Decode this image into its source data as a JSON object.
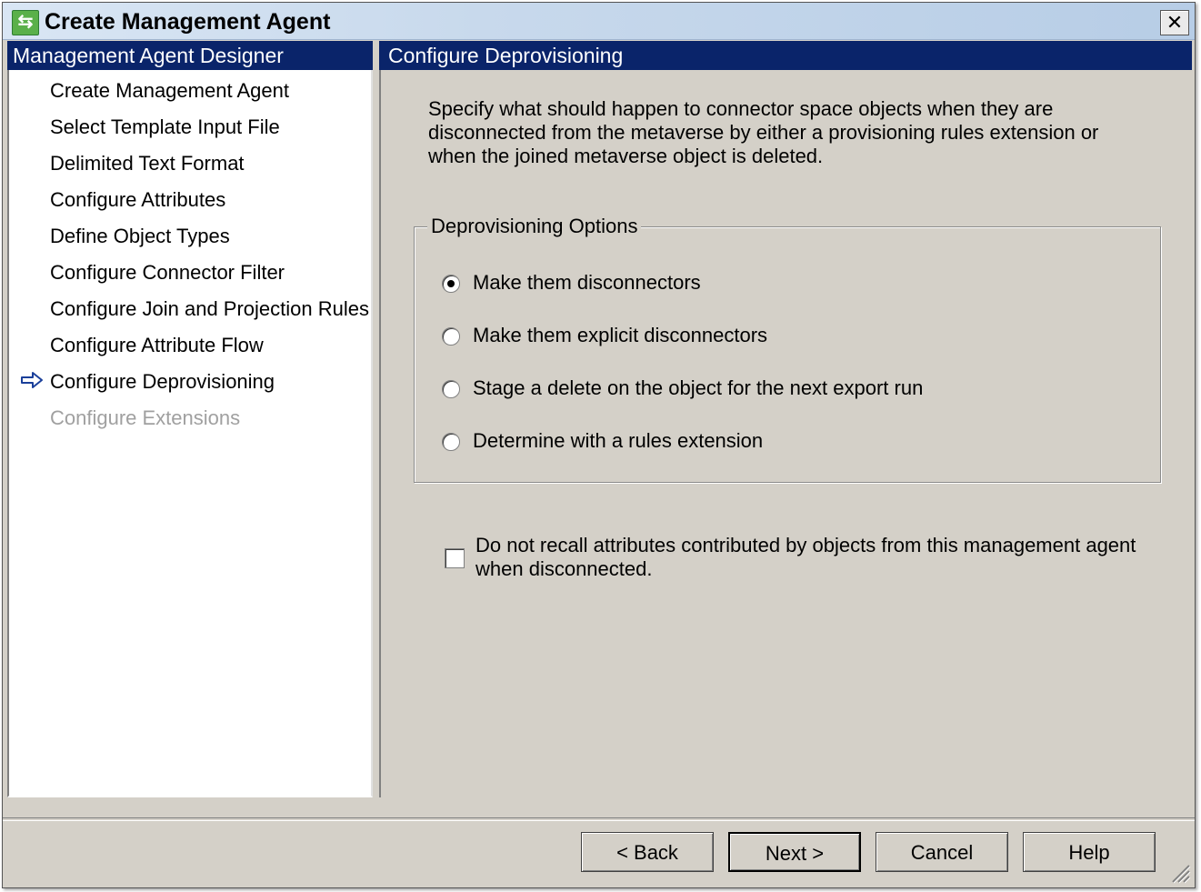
{
  "window": {
    "title": "Create Management Agent",
    "close_label": "✕"
  },
  "left_panel": {
    "header": "Management Agent Designer",
    "items": [
      {
        "label": "Create Management Agent",
        "state": "normal"
      },
      {
        "label": "Select Template Input File",
        "state": "normal"
      },
      {
        "label": "Delimited Text Format",
        "state": "normal"
      },
      {
        "label": "Configure Attributes",
        "state": "normal"
      },
      {
        "label": "Define Object Types",
        "state": "normal"
      },
      {
        "label": "Configure Connector Filter",
        "state": "normal"
      },
      {
        "label": "Configure Join and Projection Rules",
        "state": "normal"
      },
      {
        "label": "Configure Attribute Flow",
        "state": "normal"
      },
      {
        "label": "Configure Deprovisioning",
        "state": "current"
      },
      {
        "label": "Configure Extensions",
        "state": "disabled"
      }
    ]
  },
  "right_panel": {
    "header": "Configure Deprovisioning",
    "description": "Specify what should happen to connector space objects when they are disconnected from the metaverse by either a provisioning rules extension or when the joined metaverse object is deleted.",
    "group_label": "Deprovisioning Options",
    "options": [
      {
        "label": "Make them disconnectors",
        "checked": true
      },
      {
        "label": "Make them explicit disconnectors",
        "checked": false
      },
      {
        "label": "Stage a delete on the object for the next export run",
        "checked": false
      },
      {
        "label": "Determine with a rules extension",
        "checked": false
      }
    ],
    "checkbox": {
      "label": "Do not recall attributes contributed by objects from this management agent when disconnected.",
      "checked": false
    }
  },
  "buttons": {
    "back": "<  Back",
    "next": "Next  >",
    "cancel": "Cancel",
    "help": "Help"
  },
  "colors": {
    "header_bg": "#0a246a",
    "dialog_bg": "#d4d0c8",
    "disabled_text": "#a0a0a0"
  }
}
